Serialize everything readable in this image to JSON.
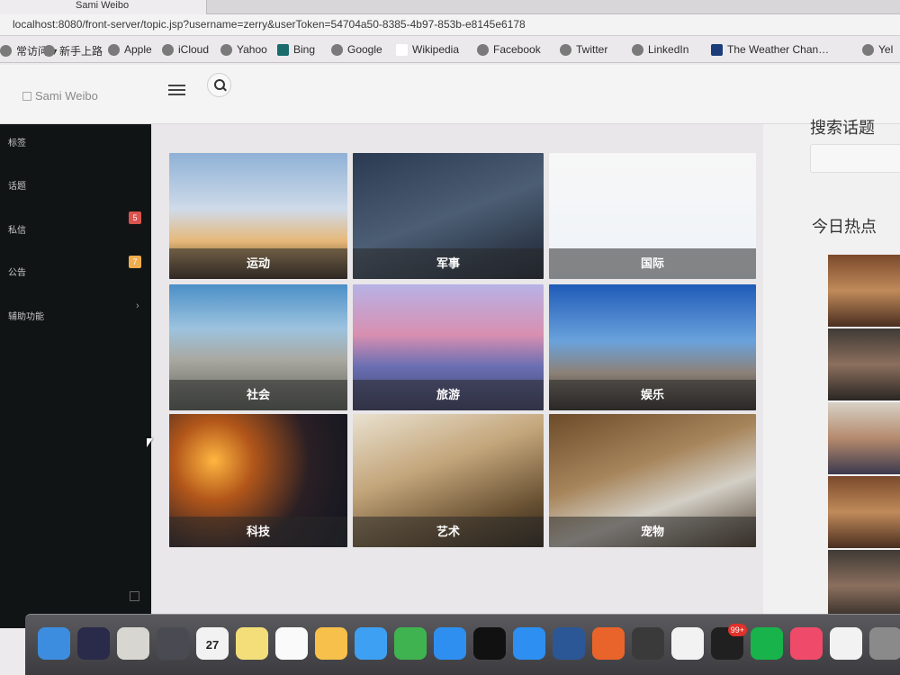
{
  "browser": {
    "tab_title": "Sami Weibo",
    "url": "localhost:8080/front-server/topic.jsp?username=zerry&userToken=54704a50-8385-4b97-853b-e8145e6178",
    "bookmarks": [
      {
        "label": "常访问 ▾",
        "icon": "gear-icon"
      },
      {
        "label": "新手上路",
        "icon": "globe-icon"
      },
      {
        "label": "Apple",
        "icon": "globe-icon"
      },
      {
        "label": "iCloud",
        "icon": "apple-icon"
      },
      {
        "label": "Yahoo",
        "icon": "globe-icon"
      },
      {
        "label": "Bing",
        "icon": "bing-icon"
      },
      {
        "label": "Google",
        "icon": "globe-icon"
      },
      {
        "label": "Wikipedia",
        "icon": "wikipedia-icon"
      },
      {
        "label": "Facebook",
        "icon": "globe-icon"
      },
      {
        "label": "Twitter",
        "icon": "globe-icon"
      },
      {
        "label": "LinkedIn",
        "icon": "globe-icon"
      },
      {
        "label": "The Weather Chan…",
        "icon": "twc-icon"
      },
      {
        "label": "Yel",
        "icon": "globe-icon"
      }
    ]
  },
  "header": {
    "brand": "Sami Weibo",
    "menu_icon": "hamburger-icon",
    "search_icon": "search-icon"
  },
  "sidebar": {
    "items": [
      {
        "label": "标签"
      },
      {
        "label": "话题"
      },
      {
        "label": "私信",
        "badge": "5",
        "badge_color": "#d9534f"
      },
      {
        "label": "公告",
        "badge": "7",
        "badge_color": "#f0ad4e"
      },
      {
        "label": "辅助功能"
      }
    ]
  },
  "topics": [
    {
      "label": "运动",
      "bg": "linear-gradient(180deg,#8fb1d6 0%,#cfdbe9 45%,#e7b878 70%,#3a2b1e 100%)"
    },
    {
      "label": "军事",
      "bg": "linear-gradient(160deg,#2a3a52 0%,#4c5e74 50%,#1b2230 100%)"
    },
    {
      "label": "国际",
      "bg": "linear-gradient(180deg,#f7f7f7 0%,#eef3f8 100%)"
    },
    {
      "label": "社会",
      "bg": "linear-gradient(180deg,#4b8fc7 0%,#9cc3df 35%,#a9a8a0 60%,#5c6159 100%)"
    },
    {
      "label": "旅游",
      "bg": "linear-gradient(180deg,#b7b2e6 0%,#d88fb0 40%,#6a6fb3 65%,#3c3f6a 100%)"
    },
    {
      "label": "娱乐",
      "bg": "linear-gradient(180deg,#1f5bb8 0%,#6aa2dc 45%,#8c8278 70%,#2e2a26 100%)"
    },
    {
      "label": "科技",
      "bg": "radial-gradient(circle at 25% 35%,#ffb640 0%,#b2561a 25%,#2a1f24 60%,#0f1520 100%)"
    },
    {
      "label": "艺术",
      "bg": "linear-gradient(160deg,#e9e1cf 0%,#c3a57a 40%,#6b5334 75%,#2b2419 100%)"
    },
    {
      "label": "宠物",
      "bg": "linear-gradient(160deg,#6c4b2a 0%,#a7855b 40%,#d3cfc6 65%,#4a3a2a 100%)"
    }
  ],
  "right_panel": {
    "search_title": "搜索话题",
    "hot_title": "今日热点",
    "thumbs": [
      {
        "bg": "linear-gradient(180deg,#7a4a2c,#c08a5a,#4a2e20)"
      },
      {
        "bg": "linear-gradient(180deg,#3f3a35,#8b6f5e,#2a2622)"
      },
      {
        "bg": "linear-gradient(180deg,#d7d1c6,#b58a6d,#3b3a4e)"
      },
      {
        "bg": "linear-gradient(180deg,#7a4a2c,#c08a5a,#4a2e20)"
      },
      {
        "bg": "linear-gradient(180deg,#3f3a35,#8b6f5e,#2a2622)"
      }
    ]
  },
  "dock": {
    "apps": [
      {
        "name": "finder-icon",
        "color": "#3c8de0"
      },
      {
        "name": "siri-icon",
        "color": "#2a2a4a"
      },
      {
        "name": "script-editor-icon",
        "color": "#d8d6d0"
      },
      {
        "name": "launchpad-icon",
        "color": "#4a4a52"
      },
      {
        "name": "calendar-icon",
        "color": "#f2f2f2",
        "text": "27"
      },
      {
        "name": "notes-icon",
        "color": "#f3de7a"
      },
      {
        "name": "reminders-icon",
        "color": "#fafafa"
      },
      {
        "name": "photos-icon",
        "color": "#f6c04a"
      },
      {
        "name": "messages-icon",
        "color": "#3ea0f2"
      },
      {
        "name": "facetime-icon",
        "color": "#3fb34f"
      },
      {
        "name": "app-store-icon",
        "color": "#2f8ff0"
      },
      {
        "name": "terminal-icon",
        "color": "#111111"
      },
      {
        "name": "safari-icon",
        "color": "#2d8ff1"
      },
      {
        "name": "word-icon",
        "color": "#2b5797"
      },
      {
        "name": "firefox-icon",
        "color": "#e8642a"
      },
      {
        "name": "stacks-icon",
        "color": "#3a3a3a"
      },
      {
        "name": "github-icon",
        "color": "#f2f2f2"
      },
      {
        "name": "qq-icon",
        "color": "#202020",
        "badge": "99+"
      },
      {
        "name": "iqiyi-icon",
        "color": "#18b34a"
      },
      {
        "name": "music-icon",
        "color": "#f04a6a"
      },
      {
        "name": "java-icon",
        "color": "#f2f2f2"
      },
      {
        "name": "misc-icon",
        "color": "#8a8a8a"
      }
    ]
  }
}
